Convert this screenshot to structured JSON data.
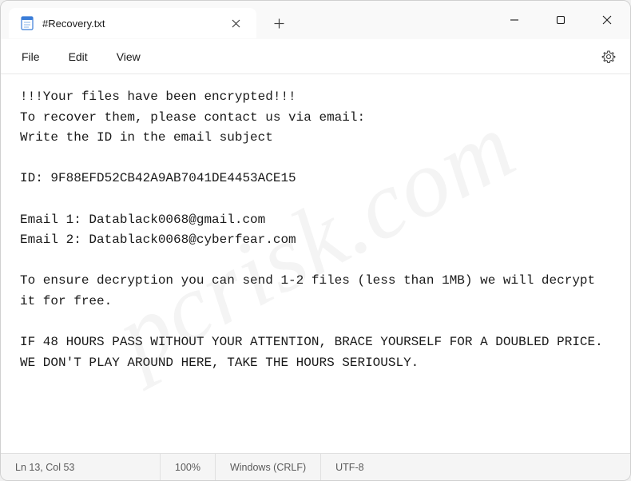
{
  "titlebar": {
    "tab_title": "#Recovery.txt"
  },
  "menu": {
    "file": "File",
    "edit": "Edit",
    "view": "View"
  },
  "content": "!!!Your files have been encrypted!!!\nTo recover them, please contact us via email:\nWrite the ID in the email subject\n\nID: 9F88EFD52CB42A9AB7041DE4453ACE15\n\nEmail 1: Datablack0068@gmail.com\nEmail 2: Datablack0068@cyberfear.com\n\nTo ensure decryption you can send 1-2 files (less than 1MB) we will decrypt it for free.\n\nIF 48 HOURS PASS WITHOUT YOUR ATTENTION, BRACE YOURSELF FOR A DOUBLED PRICE.\nWE DON'T PLAY AROUND HERE, TAKE THE HOURS SERIOUSLY.",
  "statusbar": {
    "position": "Ln 13, Col 53",
    "zoom": "100%",
    "line_ending": "Windows (CRLF)",
    "encoding": "UTF-8"
  },
  "watermark": "pcrisk.com"
}
